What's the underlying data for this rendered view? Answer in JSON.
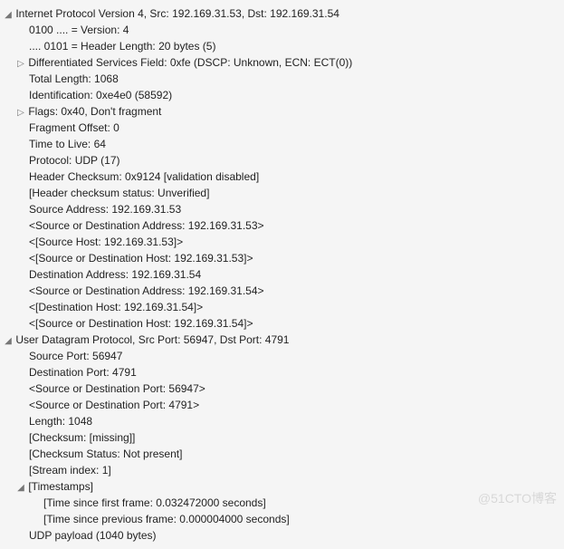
{
  "ip": {
    "header": "Internet Protocol Version 4, Src: 192.169.31.53, Dst: 192.169.31.54",
    "version": "0100 .... = Version: 4",
    "hdrlen": ".... 0101 = Header Length: 20 bytes (5)",
    "dsfield": "Differentiated Services Field: 0xfe (DSCP: Unknown, ECN: ECT(0))",
    "totlen": "Total Length: 1068",
    "id": "Identification: 0xe4e0 (58592)",
    "flags": "Flags: 0x40, Don't fragment",
    "fragoff": "Fragment Offset: 0",
    "ttl": "Time to Live: 64",
    "protocol": "Protocol: UDP (17)",
    "checksum": "Header Checksum: 0x9124 [validation disabled]",
    "checksum_status": "[Header checksum status: Unverified]",
    "src": "Source Address: 192.169.31.53",
    "srcdst_addr": "<Source or Destination Address: 192.169.31.53>",
    "srchost": "<[Source Host: 192.169.31.53]>",
    "srcdst_host": "<[Source or Destination Host: 192.169.31.53]>",
    "dst": "Destination Address: 192.169.31.54",
    "srcdst_addr2": "<Source or Destination Address: 192.169.31.54>",
    "dsthost": "<[Destination Host: 192.169.31.54]>",
    "srcdst_host2": "<[Source or Destination Host: 192.169.31.54]>"
  },
  "udp": {
    "header": "User Datagram Protocol, Src Port: 56947, Dst Port: 4791",
    "srcport": "Source Port: 56947",
    "dstport": "Destination Port: 4791",
    "sdport": "<Source or Destination Port: 56947>",
    "sdport2": "<Source or Destination Port: 4791>",
    "length": "Length: 1048",
    "checksum": "[Checksum: [missing]]",
    "checksum_status": "[Checksum Status: Not present]",
    "stream": "[Stream index: 1]",
    "timestamps_label": "[Timestamps]",
    "ts_first": "[Time since first frame: 0.032472000 seconds]",
    "ts_prev": "[Time since previous frame: 0.000004000 seconds]",
    "payload": "UDP payload (1040 bytes)"
  },
  "watermark": "@51CTO博客"
}
